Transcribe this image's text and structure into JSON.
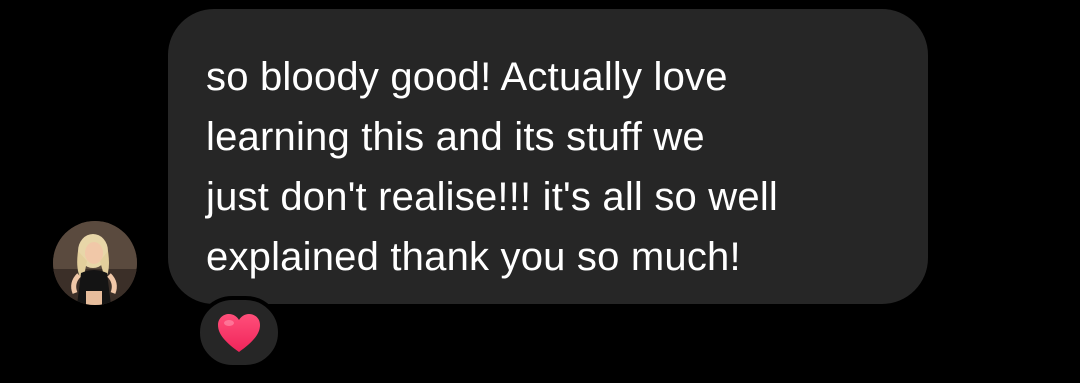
{
  "message": {
    "text": "so bloody good! Actually love\nlearning this and its stuff we\njust don't realise!!! it's all so well\nexplained thank you so much!"
  },
  "reaction": {
    "icon": "heart-icon",
    "color": "#ff2e63"
  },
  "sender": {
    "avatar_icon": "profile-photo"
  },
  "colors": {
    "background": "#000000",
    "bubble": "#262626",
    "text": "#ffffff"
  }
}
